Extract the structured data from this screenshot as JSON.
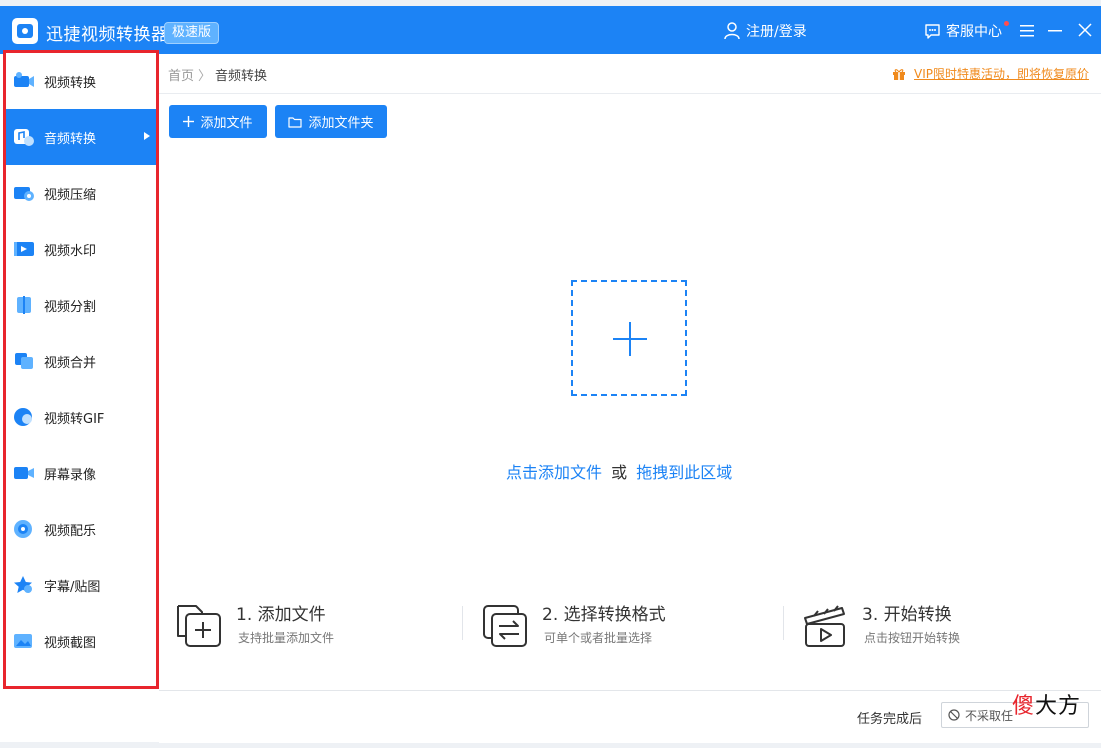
{
  "app": {
    "title": "迅捷视频转换器",
    "edition": "极速版",
    "login": "注册/登录",
    "service": "客服中心"
  },
  "sidebar": {
    "items": [
      {
        "label": "视频转换",
        "icon": "video-convert-icon"
      },
      {
        "label": "音频转换",
        "icon": "audio-convert-icon",
        "active": true
      },
      {
        "label": "视频压缩",
        "icon": "video-compress-icon"
      },
      {
        "label": "视频水印",
        "icon": "video-watermark-icon"
      },
      {
        "label": "视频分割",
        "icon": "video-split-icon"
      },
      {
        "label": "视频合并",
        "icon": "video-merge-icon"
      },
      {
        "label": "视频转GIF",
        "icon": "video-gif-icon"
      },
      {
        "label": "屏幕录像",
        "icon": "screen-record-icon"
      },
      {
        "label": "视频配乐",
        "icon": "video-music-icon"
      },
      {
        "label": "字幕/贴图",
        "icon": "subtitle-sticker-icon"
      },
      {
        "label": "视频截图",
        "icon": "video-screenshot-icon"
      }
    ]
  },
  "breadcrumb": {
    "home": "首页",
    "current": "音频转换"
  },
  "vip": {
    "text": "VIP限时特惠活动，即将恢复原价"
  },
  "toolbar": {
    "add_file": "添加文件",
    "add_folder": "添加文件夹"
  },
  "dropzone": {
    "click_text": "点击添加文件",
    "or_text": "或",
    "drag_text": "拖拽到此区域"
  },
  "steps": [
    {
      "title": "1. 添加文件",
      "desc": "支持批量添加文件"
    },
    {
      "title": "2. 选择转换格式",
      "desc": "可单个或者批量选择"
    },
    {
      "title": "3. 开始转换",
      "desc": "点击按钮开始转换"
    }
  ],
  "footer": {
    "after_label": "任务完成后",
    "after_value": "不采取任"
  },
  "watermark": {
    "first": "傻",
    "rest": "大方"
  },
  "colors": {
    "accent": "#1c83f5",
    "highlight_border": "#e8252d",
    "vip": "#f08a1c"
  }
}
